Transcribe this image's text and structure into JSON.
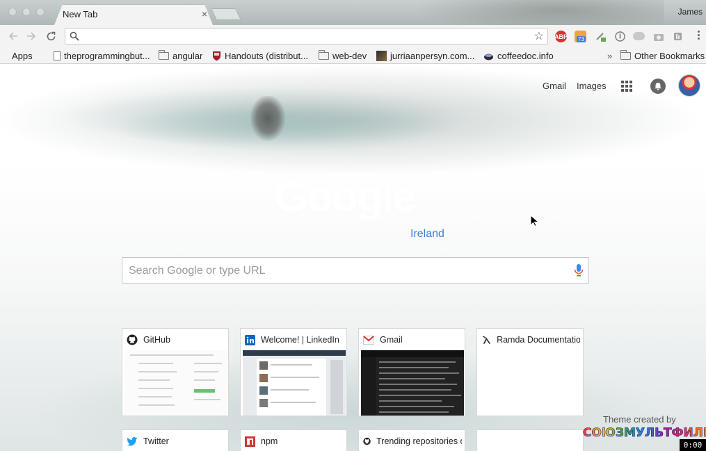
{
  "browser": {
    "profile_name": "James",
    "tabs": [
      {
        "title": "New Tab",
        "close_glyph": "×"
      }
    ]
  },
  "toolbar": {
    "omnibox_value": "",
    "back_icon": "arrow-left-icon",
    "forward_icon": "arrow-right-icon",
    "reload_icon": "reload-icon",
    "extensions": [
      {
        "name": "adblock-plus-icon",
        "label": "ABP",
        "color": "#d9342b"
      },
      {
        "name": "rss-feed-icon",
        "label": "73",
        "color": "#f2a33a",
        "badge_color": "#4a7cd9"
      },
      {
        "name": "puzzle-extension-icon",
        "label": "",
        "color": "#6aa84f"
      },
      {
        "name": "info-circle-icon",
        "label": "",
        "color": "#777777"
      },
      {
        "name": "cloud-icon",
        "label": "",
        "color": "#b7b7b7"
      },
      {
        "name": "camera-icon",
        "label": "",
        "color": "#a8a8a8"
      },
      {
        "name": "plugin-icon",
        "label": "",
        "color": "#9a9a9a"
      }
    ]
  },
  "bookmarks": {
    "items": [
      {
        "label": "Apps",
        "icon": "apps-grid-icon"
      },
      {
        "label": "theprogrammingbut...",
        "icon": "page-icon"
      },
      {
        "label": "angular",
        "icon": "folder-icon"
      },
      {
        "label": "Handouts (distribut...",
        "icon": "harvard-shield-icon"
      },
      {
        "label": "web-dev",
        "icon": "folder-icon"
      },
      {
        "label": "jurriaanpersyn.com...",
        "icon": "site-favicon-icon"
      },
      {
        "label": "coffeedoc.info",
        "icon": "coffee-icon"
      }
    ],
    "overflow": "»",
    "other_bookmarks": "Other Bookmarks"
  },
  "ntp": {
    "links": {
      "gmail": "Gmail",
      "images": "Images"
    },
    "logo_text": "Google",
    "logo_sub": "Ireland",
    "search_placeholder": "Search Google or type URL",
    "tiles": [
      {
        "title": "GitHub",
        "icon": "github-icon",
        "thumb": "light"
      },
      {
        "title": "Welcome! | LinkedIn",
        "icon": "linkedin-icon",
        "thumb": "mixed"
      },
      {
        "title": "Gmail",
        "icon": "gmail-icon",
        "thumb": "dark"
      },
      {
        "title": "Ramda Documentation",
        "icon": "ramda-icon",
        "thumb": "blank"
      },
      {
        "title": "Twitter",
        "icon": "twitter-icon"
      },
      {
        "title": "npm",
        "icon": "npm-icon"
      },
      {
        "title": "Trending repositories on GitHub",
        "icon": "github-icon"
      },
      {
        "title": "",
        "icon": ""
      }
    ],
    "theme_credit": "Theme created by",
    "theme_logo": "СОЮЗМУЛЬТФИЛЬМ",
    "timer": "0:00"
  },
  "colors": {
    "accent_link": "#3b7fd6",
    "github": "#222222",
    "linkedin": "#0a66c2",
    "gmail_red": "#d93025",
    "twitter": "#1da1f2",
    "npm": "#cb3837"
  }
}
